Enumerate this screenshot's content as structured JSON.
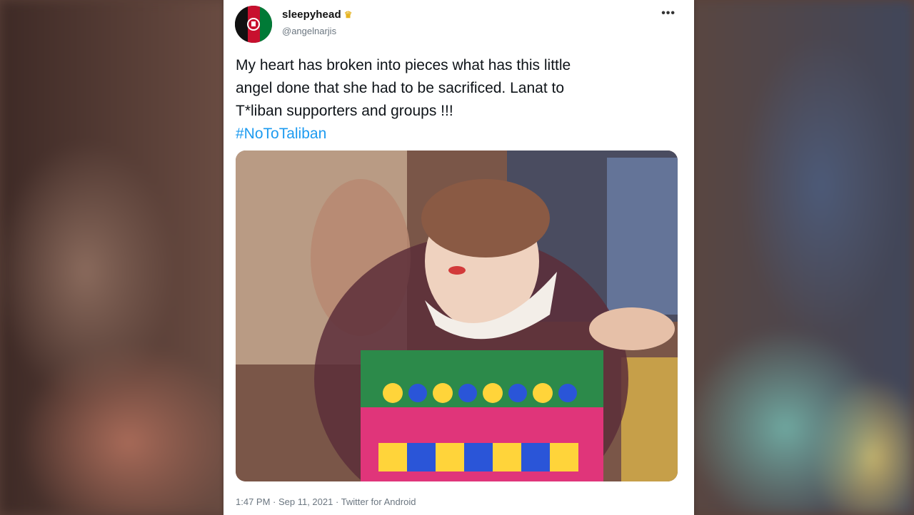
{
  "user": {
    "display_name": "sleepyhead",
    "badge_icon": "crown-icon",
    "handle": "@angelnarjis",
    "avatar_icon": "afghan-flag-icon"
  },
  "menu": {
    "more_label": "•••"
  },
  "tweet": {
    "line1": "My heart has broken into pieces what has this little",
    "line2": "angel done that she had to be sacrificed. Lanat to",
    "line3": "T*liban supporters and groups !!!",
    "hashtag": "#NoToTaliban"
  },
  "meta": {
    "footer": "1:47 PM · Sep 11, 2021 · Twitter for Android"
  },
  "colors": {
    "link": "#1d9bf0",
    "text": "#0f1419",
    "muted": "#6b7680",
    "crown": "#e6b422"
  }
}
